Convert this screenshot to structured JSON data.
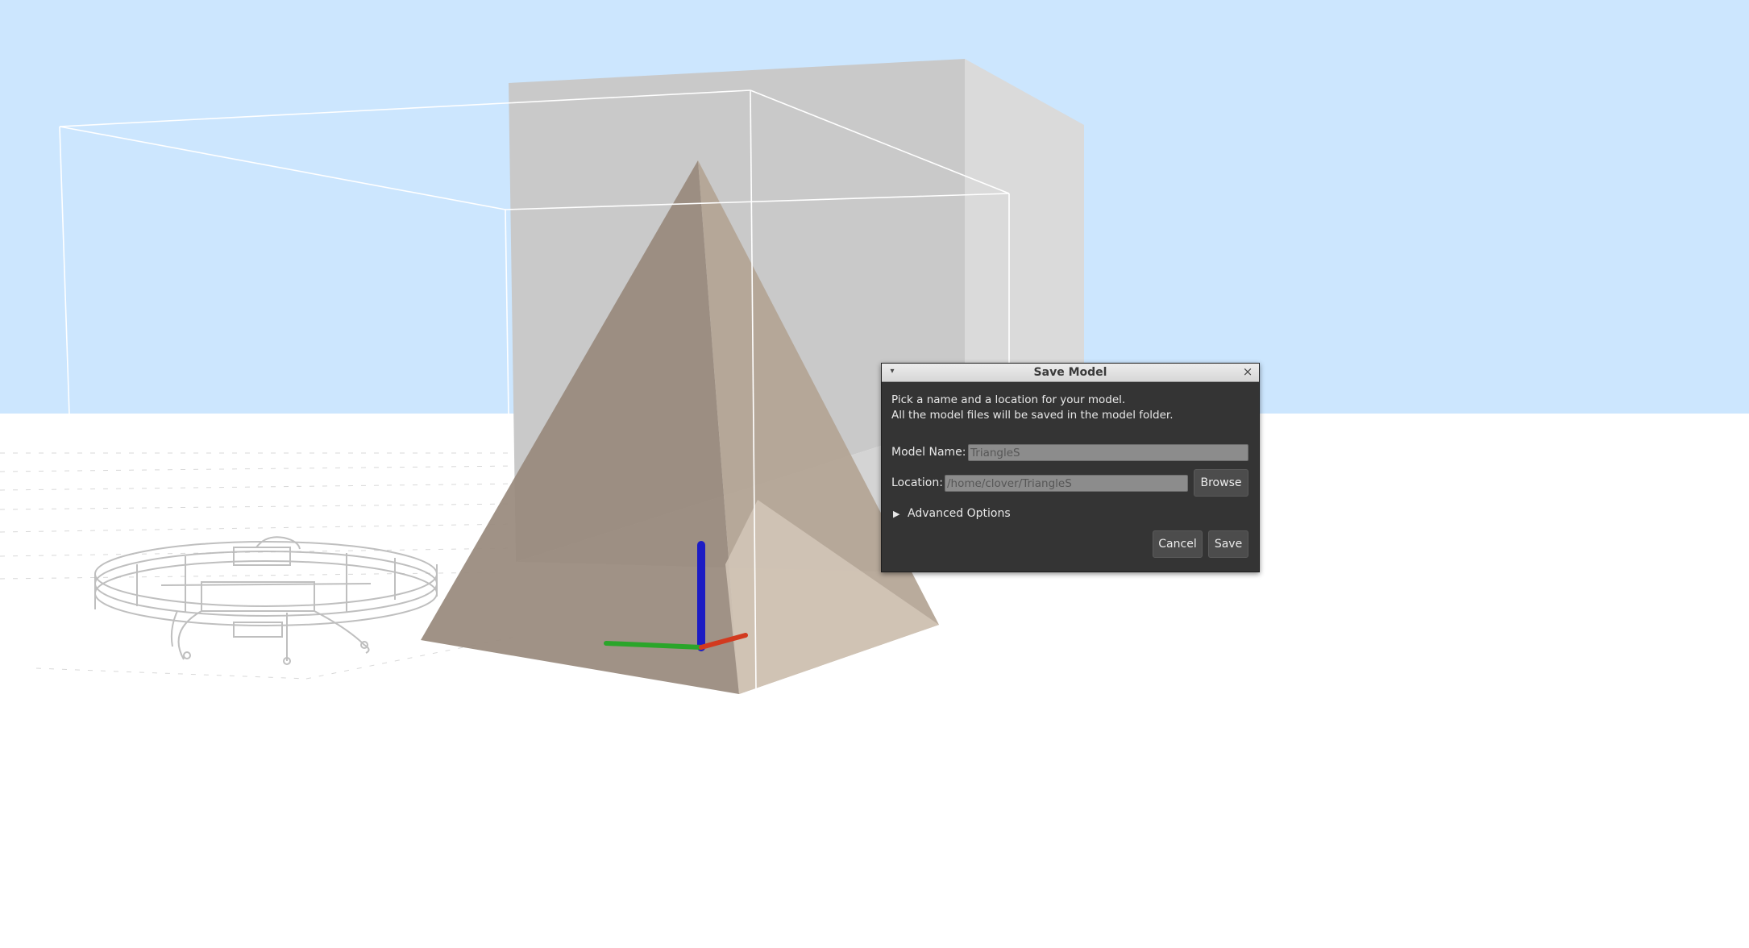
{
  "scene": {
    "sky_color": "#cce6fe",
    "ground_color": "#ffffff",
    "objects": [
      "quadcopter-drone",
      "pyramid",
      "box",
      "xyz-axes-gizmo"
    ],
    "axis_colors": {
      "x": "#d23a1f",
      "y": "#2aa52a",
      "z": "#1c1cc4"
    }
  },
  "dialog": {
    "title": "Save Model",
    "menu_icon": "chevron-down-icon",
    "close_icon": "close-icon",
    "description_line1": "Pick a name and a location for your model.",
    "description_line2": "All the model files will be saved in the model folder.",
    "model_name_label": "Model Name:",
    "model_name_placeholder": "TriangleS",
    "location_label": "Location:",
    "location_placeholder": "/home/clover/TriangleS",
    "browse_label": "Browse",
    "advanced_label": "Advanced Options",
    "cancel_label": "Cancel",
    "save_label": "Save"
  }
}
